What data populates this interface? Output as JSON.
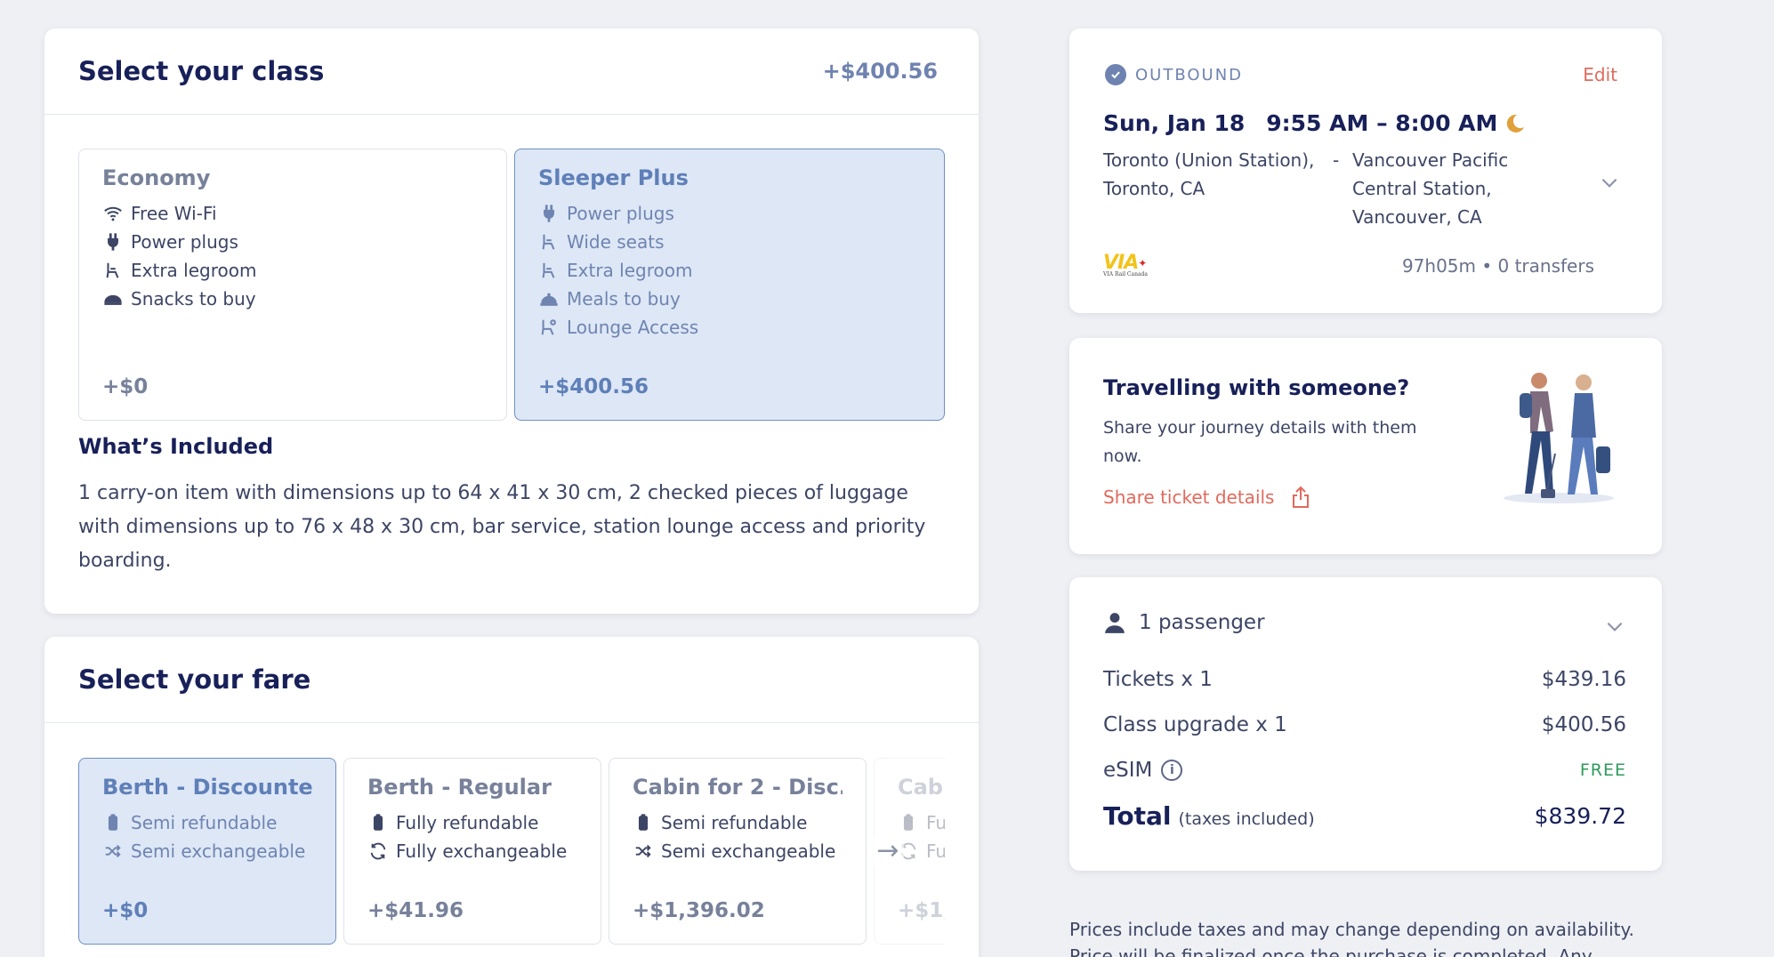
{
  "class_section": {
    "title": "Select your class",
    "header_price": "+$400.56",
    "options": [
      {
        "name": "Economy",
        "features": [
          {
            "icon": "wifi-icon",
            "label": "Free Wi-Fi"
          },
          {
            "icon": "plug-icon",
            "label": "Power plugs"
          },
          {
            "icon": "seat-icon",
            "label": "Extra legroom"
          },
          {
            "icon": "snack-icon",
            "label": "Snacks to buy"
          }
        ],
        "price": "+$0",
        "selected": false
      },
      {
        "name": "Sleeper Plus",
        "features": [
          {
            "icon": "plug-icon",
            "label": "Power plugs"
          },
          {
            "icon": "seat-icon",
            "label": "Wide seats"
          },
          {
            "icon": "seat-icon",
            "label": "Extra legroom"
          },
          {
            "icon": "meal-icon",
            "label": "Meals to buy"
          },
          {
            "icon": "lounge-icon",
            "label": "Lounge Access"
          }
        ],
        "price": "+$400.56",
        "selected": true
      }
    ],
    "included_title": "What’s Included",
    "included_text": "1 carry-on item with dimensions up to 64 x 41 x 30 cm, 2 checked pieces of luggage with dimensions up to 76 x 48 x 30 cm, bar service, station lounge access and priority boarding."
  },
  "fare_section": {
    "title": "Select your fare",
    "fares": [
      {
        "name": "Berth - Discounted",
        "features": [
          {
            "icon": "refund-icon",
            "label": "Semi refundable"
          },
          {
            "icon": "exchange-icon",
            "label": "Semi exchangeable"
          }
        ],
        "price": "+$0",
        "selected": true
      },
      {
        "name": "Berth - Regular",
        "features": [
          {
            "icon": "refund-icon",
            "label": "Fully refundable"
          },
          {
            "icon": "exchange-icon",
            "label": "Fully exchangeable"
          }
        ],
        "price": "+$41.96",
        "selected": false
      },
      {
        "name": "Cabin for 2 - Disc...",
        "features": [
          {
            "icon": "refund-icon",
            "label": "Semi refundable"
          },
          {
            "icon": "exchange-icon",
            "label": "Semi exchangeable"
          }
        ],
        "price": "+$1,396.02",
        "selected": false
      },
      {
        "name": "Cab",
        "features": [
          {
            "icon": "refund-icon",
            "label": "Fu"
          },
          {
            "icon": "exchange-icon",
            "label": "Fu"
          }
        ],
        "price": "+$1,",
        "selected": false
      }
    ]
  },
  "outbound": {
    "label": "OUTBOUND",
    "edit_label": "Edit",
    "date": "Sun, Jan 18",
    "time": "9:55 AM – 8:00 AM",
    "from_station": "Toronto (Union Station), Toronto, CA",
    "dash": "-",
    "to_station": "Vancouver Pacific Central Station, Vancouver, CA",
    "operator_logo_text": "VIA",
    "operator_logo_sub": "VIA Rail Canada",
    "duration": "97h05m • 0 transfers"
  },
  "share": {
    "title": "Travelling with someone?",
    "text": "Share your journey details with them now.",
    "link_label": "Share ticket details"
  },
  "passengers": {
    "label": "1 passenger",
    "rows": [
      {
        "label": "Tickets x 1",
        "value": "$439.16"
      },
      {
        "label": "Class upgrade x 1",
        "value": "$400.56"
      }
    ],
    "esim_label": "eSIM",
    "esim_value": "FREE",
    "total_label": "Total",
    "total_sub": "(taxes included)",
    "total_value": "$839.72"
  },
  "disclaimer": "Prices include taxes and may change depending on availability. Price will be finalized once the purchase is completed. Any"
}
